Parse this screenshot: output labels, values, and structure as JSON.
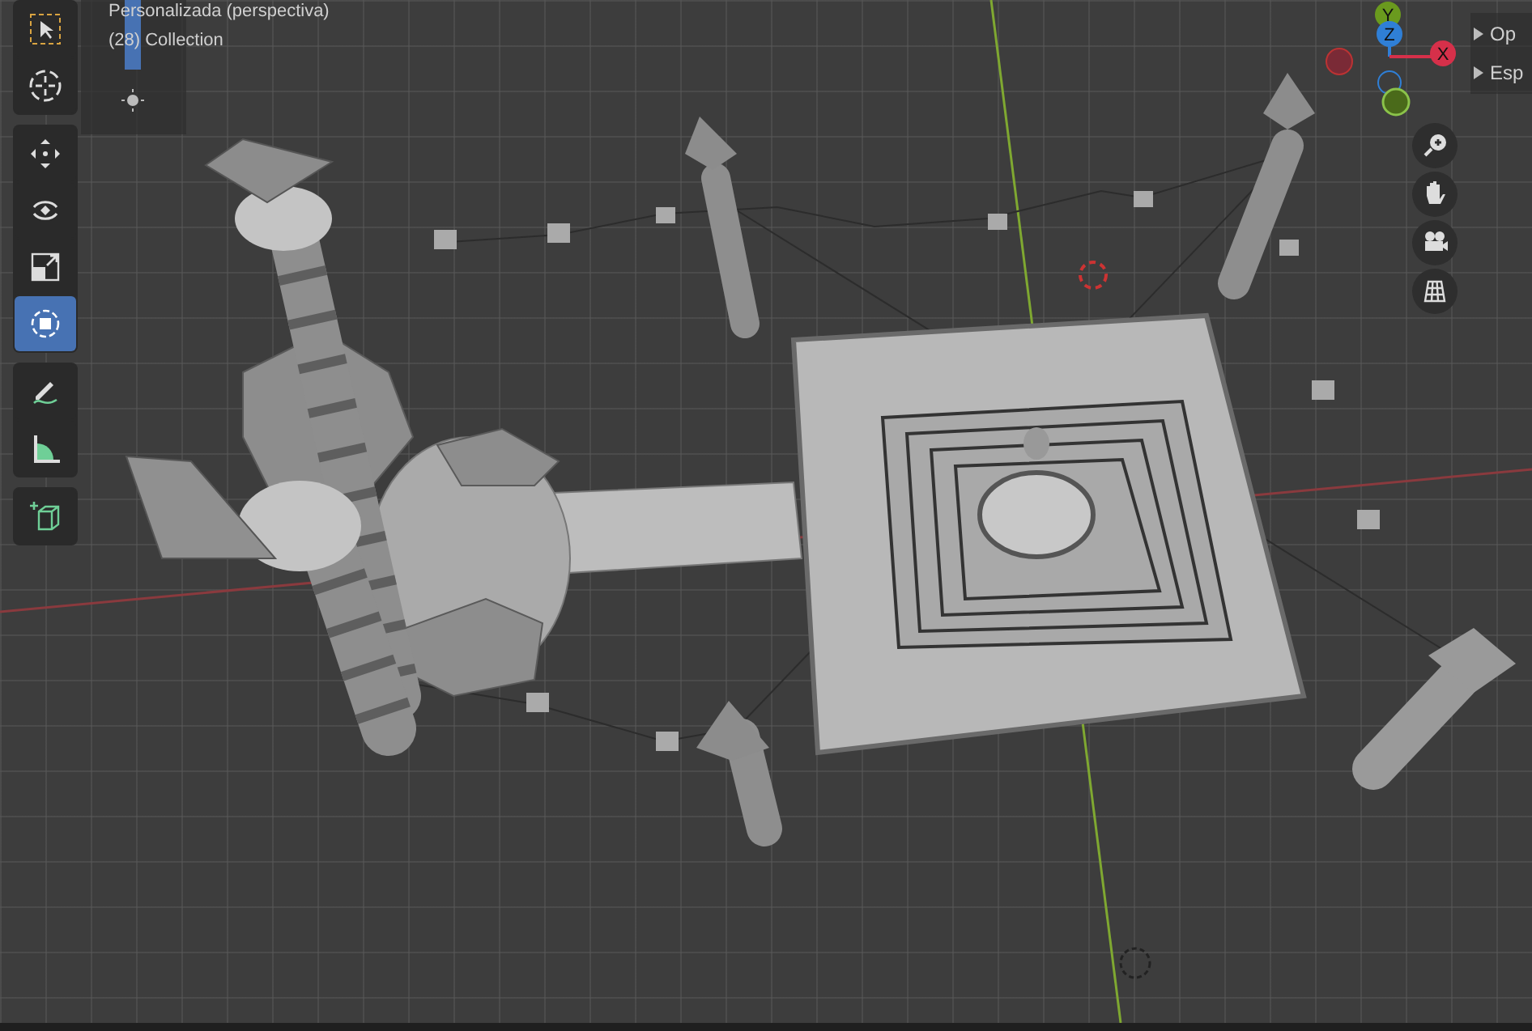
{
  "viewport": {
    "view_name": "Personalizada (perspectiva)",
    "collection": "(28) Collection"
  },
  "toolbar": {
    "groups": [
      [
        {
          "kind": "select-box",
          "selected": false
        },
        {
          "kind": "cursor",
          "selected": false
        }
      ],
      [
        {
          "kind": "move",
          "selected": false
        },
        {
          "kind": "rotate",
          "selected": false
        },
        {
          "kind": "scale",
          "selected": false
        },
        {
          "kind": "transform",
          "selected": true
        }
      ],
      [
        {
          "kind": "annotate",
          "selected": false
        },
        {
          "kind": "measure",
          "selected": false
        }
      ],
      [
        {
          "kind": "add-cube",
          "selected": false
        }
      ]
    ]
  },
  "gizmo": {
    "axes": [
      {
        "label": "Y",
        "kind": "y"
      },
      {
        "label": "Z",
        "kind": "z"
      },
      {
        "label": "X",
        "kind": "x"
      }
    ]
  },
  "side_panel": {
    "items": [
      "Op",
      "Esp"
    ]
  }
}
